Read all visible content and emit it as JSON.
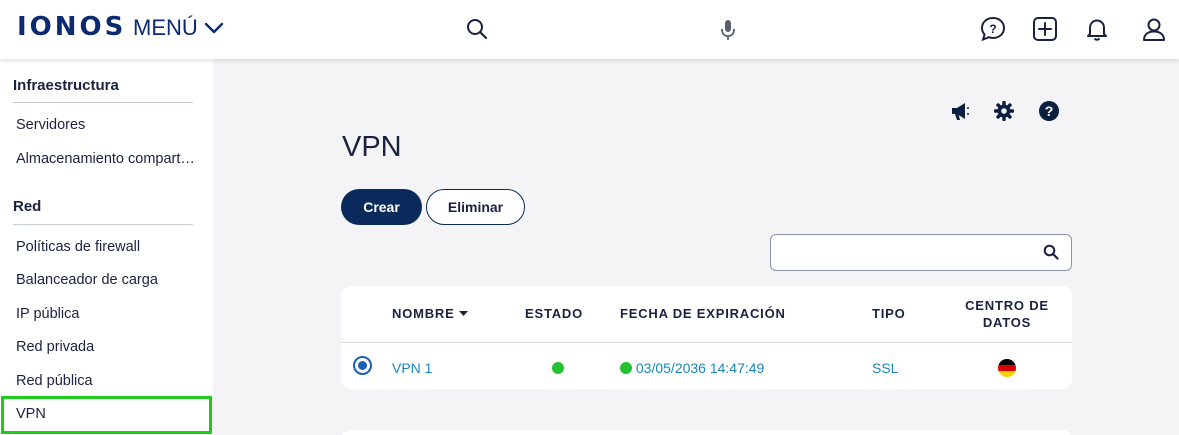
{
  "header": {
    "logo": "IONOS",
    "menu_label": "MENÚ",
    "icons": [
      "search-icon",
      "microphone-icon",
      "help-chat-icon",
      "add-icon",
      "notifications-icon",
      "user-icon"
    ]
  },
  "sidebar": {
    "sections": [
      {
        "title": "Infraestructura",
        "items": [
          "Servidores",
          "Almacenamiento compart…"
        ]
      },
      {
        "title": "Red",
        "items": [
          "Políticas de firewall",
          "Balanceador de carga",
          "IP pública",
          "Red privada",
          "Red pública",
          "VPN"
        ]
      }
    ],
    "selected": "VPN"
  },
  "main": {
    "title": "VPN",
    "actions": {
      "create": "Crear",
      "delete": "Eliminar"
    },
    "search": {
      "placeholder": "",
      "value": ""
    },
    "tool_icons": [
      "announcement-icon",
      "settings-icon",
      "help-icon"
    ],
    "table": {
      "columns": [
        "NOMBRE",
        "ESTADO",
        "FECHA DE EXPIRACIÓN",
        "TIPO",
        "CENTRO DE DATOS"
      ],
      "rows": [
        {
          "name": "VPN 1",
          "status": "active",
          "expiration": "03/05/2036 14:47:49",
          "type": "SSL",
          "datacenter": "de-flag"
        }
      ]
    }
  },
  "colors": {
    "brand": "#0b2a6f",
    "primary_button": "#0b2a5c",
    "link": "#1a86b8",
    "status_ok": "#22c232",
    "highlight": "#1fca1a"
  }
}
